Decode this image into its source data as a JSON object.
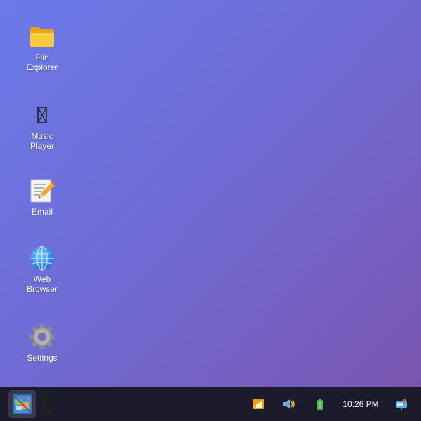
{
  "desktop": {
    "icons": [
      {
        "label": "File\nExplorer",
        "icon": "folder-icon"
      },
      {
        "label": "Music\nPlayer",
        "icon": "music-icon"
      },
      {
        "label": "Email",
        "icon": "email-icon"
      },
      {
        "label": "Web\nBrowser",
        "icon": "globe-icon"
      },
      {
        "label": "Settings",
        "icon": "gear-icon"
      }
    ],
    "background": {
      "from": "#6a7ae8",
      "to": "#7a55b0"
    }
  },
  "taskbar": {
    "start_icon": "start-menu-icon",
    "tray": {
      "network_icon": "signal-bars-icon",
      "volume_icon": "speaker-icon",
      "battery_icon": "battery-icon",
      "clock": "10:26 PM",
      "notifications_icon": "mailbox-icon"
    },
    "background": "#1c1b2b"
  }
}
